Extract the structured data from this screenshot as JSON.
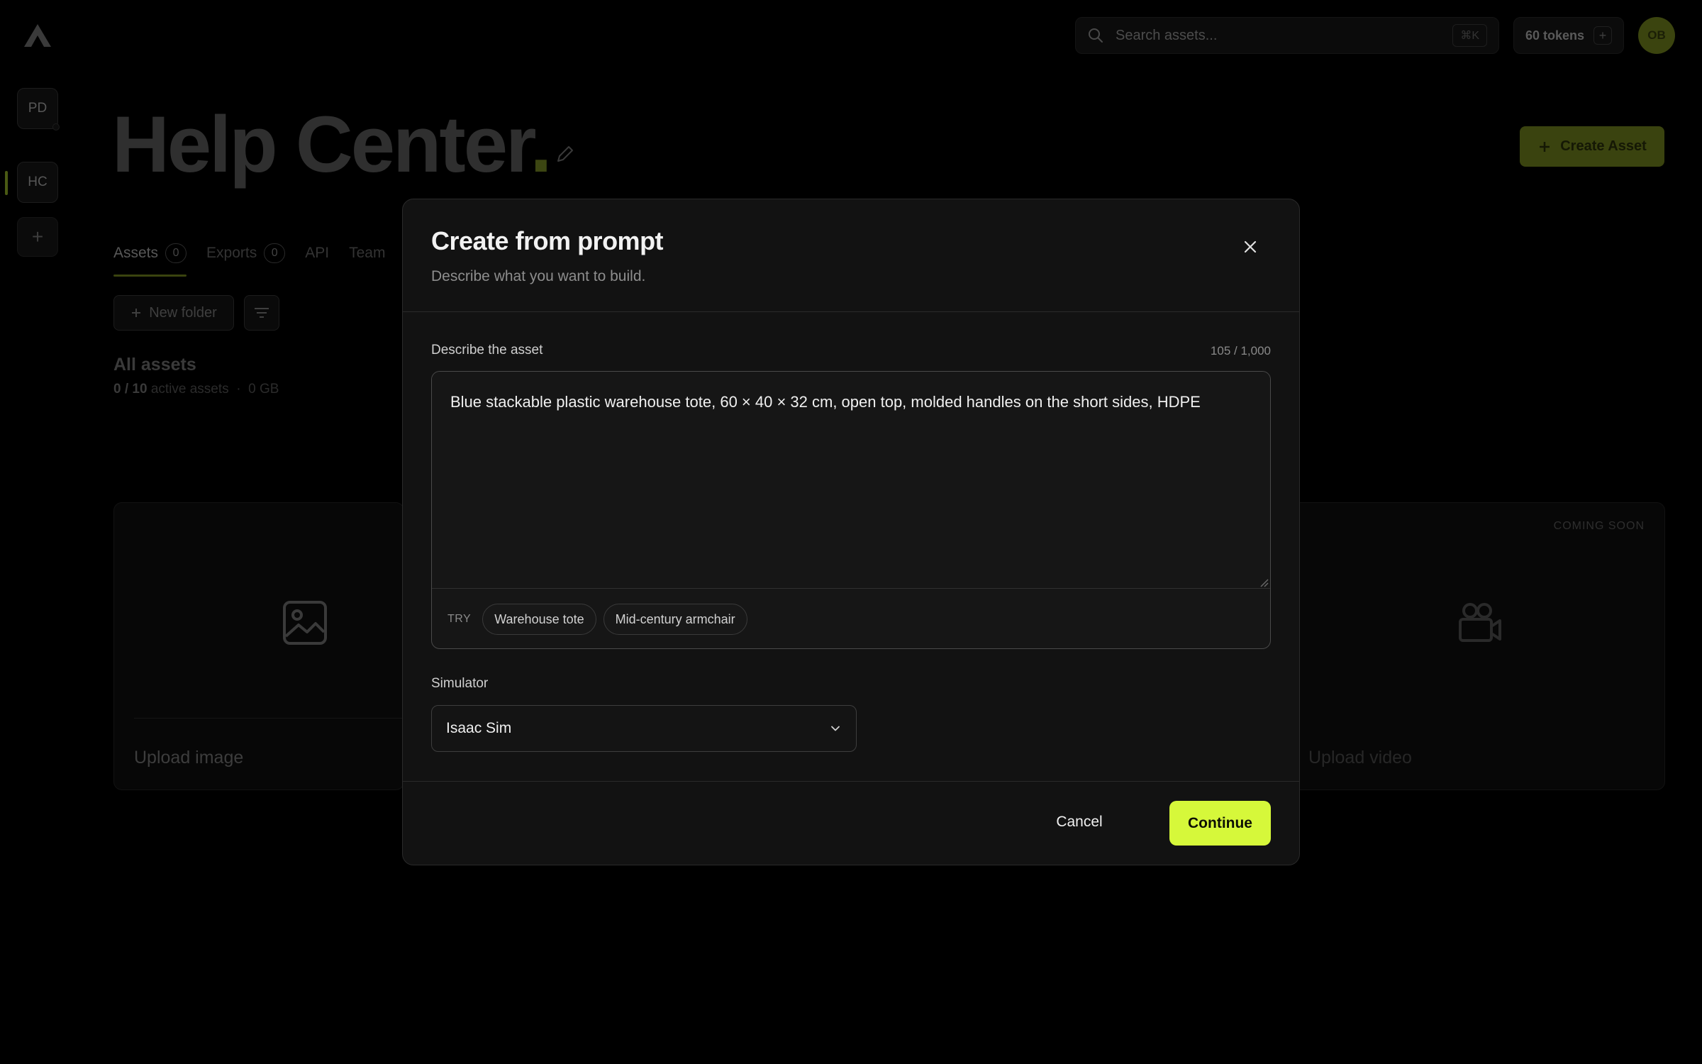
{
  "sidebar": {
    "workspaces": [
      {
        "initials": "PD"
      },
      {
        "initials": "HC"
      }
    ],
    "add_label": "+"
  },
  "topbar": {
    "search_placeholder": "Search assets...",
    "search_shortcut": "⌘K",
    "tokens_label": "60 tokens",
    "tokens_plus": "+",
    "avatar_initials": "OB"
  },
  "page": {
    "title": "Help Center",
    "title_period": ".",
    "create_button": "Create Asset",
    "tabs": [
      {
        "label": "Assets",
        "count": "0"
      },
      {
        "label": "Exports",
        "count": "0"
      },
      {
        "label": "API",
        "count": ""
      },
      {
        "label": "Team",
        "count": ""
      }
    ],
    "new_folder": "New folder",
    "section_title": "All assets",
    "active_count": "0 / 10",
    "active_label": "active assets",
    "dot_sep": "·",
    "storage": "0 GB",
    "cards": {
      "image_label": "Upload image",
      "video_label": "Upload video",
      "coming_soon": "COMING SOON"
    }
  },
  "modal": {
    "title": "Create from prompt",
    "subtitle": "Describe what you want to build.",
    "prompt_label": "Describe the asset",
    "char_count": "105 / 1,000",
    "prompt_value": "Blue stackable plastic warehouse tote, 60 × 40 × 32 cm, open top, molded handles on the short sides, HDPE",
    "try_label": "TRY",
    "suggestions": [
      "Warehouse tote",
      "Mid-century armchair"
    ],
    "simulator_label": "Simulator",
    "simulator_value": "Isaac Sim",
    "cancel": "Cancel",
    "continue": "Continue"
  },
  "colors": {
    "accent": "#d6f83a",
    "modal_bg": "#121212",
    "backdrop": "#000000"
  }
}
